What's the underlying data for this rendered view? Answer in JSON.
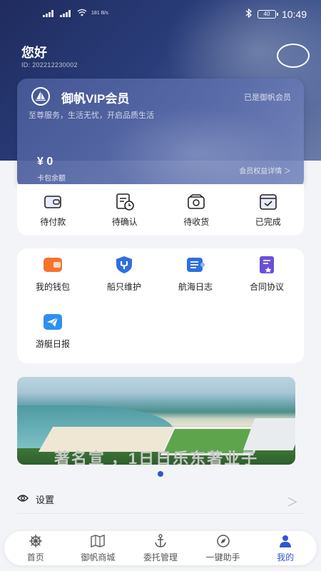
{
  "status_bar": {
    "net_speed": "181\nB/s",
    "battery": "40",
    "time": "10:49"
  },
  "header": {
    "greeting": "您好",
    "user_id": "ID:  202212230002"
  },
  "vip_card": {
    "title": "御帆VIP会员",
    "status": "已是御帆会员",
    "subtitle": "至尊服务，生活无忧，开启品质生活",
    "balance": "¥ 0",
    "balance_label": "卡包余额",
    "benefits_link": "会员权益详情 ＞"
  },
  "orders": [
    {
      "label": "待付款",
      "icon": "wallet-icon"
    },
    {
      "label": "待确认",
      "icon": "clock-list-icon"
    },
    {
      "label": "待收货",
      "icon": "package-icon"
    },
    {
      "label": "已完成",
      "icon": "check-box-icon"
    }
  ],
  "services": [
    {
      "label": "我的钱包",
      "icon": "wallet-icon",
      "color": "#f5732e"
    },
    {
      "label": "船只维护",
      "icon": "wrench-shield-icon",
      "color": "#2e6fe0"
    },
    {
      "label": "航海日志",
      "icon": "log-icon",
      "color": "#2e6fe0"
    },
    {
      "label": "合同协议",
      "icon": "contract-icon",
      "color": "#6b4fd8"
    },
    {
      "label": "游艇日报",
      "icon": "paper-plane-icon",
      "color": "#2e8ff0"
    }
  ],
  "banner": {
    "caption": "著名宣 ，1日日乐东著业子"
  },
  "settings": {
    "label": "设置",
    "chevron": "＞"
  },
  "tabbar": [
    {
      "label": "首页",
      "icon": "helm-icon",
      "active": false
    },
    {
      "label": "御帆商城",
      "icon": "map-icon",
      "active": false
    },
    {
      "label": "委托管理",
      "icon": "anchor-icon",
      "active": false
    },
    {
      "label": "一键助手",
      "icon": "compass-icon",
      "active": false
    },
    {
      "label": "我的",
      "icon": "user-icon",
      "active": true
    }
  ],
  "colors": {
    "accent": "#2e56d1",
    "header_dark": "#1f2b5e"
  }
}
